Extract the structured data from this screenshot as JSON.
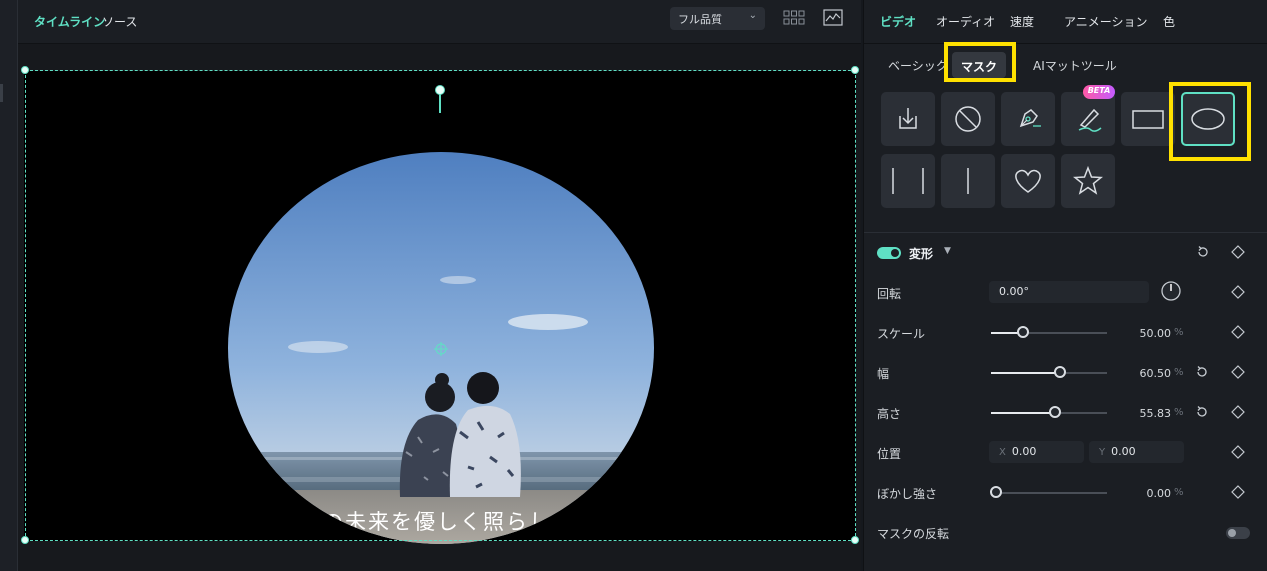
{
  "preview": {
    "tabs": [
      "タイムライン",
      "ソース"
    ],
    "quality": "フル品質",
    "subtitle_text": "の未来を優しく照らし"
  },
  "panel": {
    "tabs": [
      "ビデオ",
      "オーディオ",
      "速度",
      "アニメーション",
      "色"
    ],
    "subtabs": [
      "ベーシック",
      "マスク",
      "AIマットツール"
    ],
    "shapes": [
      "import-icon",
      "none-icon",
      "pen-icon",
      "brush-icon",
      "rectangle-icon",
      "ellipse-icon",
      "double-line-icon",
      "single-line-icon",
      "heart-icon",
      "star-icon"
    ],
    "beta_badge": "BETA",
    "section_title": "変形",
    "rotation": {
      "label": "回転",
      "value": "0.00°"
    },
    "scale": {
      "label": "スケール",
      "value": "50.00",
      "unit": "%",
      "fraction": 0.27
    },
    "width": {
      "label": "幅",
      "value": "60.50",
      "unit": "%",
      "fraction": 0.59
    },
    "height": {
      "label": "高さ",
      "value": "55.83",
      "unit": "%",
      "fraction": 0.55
    },
    "position": {
      "label": "位置",
      "x_axis": "X",
      "x": "0.00",
      "y_axis": "Y",
      "y": "0.00"
    },
    "blur": {
      "label": "ぼかし強さ",
      "value": "0.00",
      "unit": "%",
      "fraction": 0.0
    },
    "invert": {
      "label": "マスクの反転"
    }
  },
  "colors": {
    "accent": "#5fe0c4",
    "highlight": "#ffe100"
  }
}
